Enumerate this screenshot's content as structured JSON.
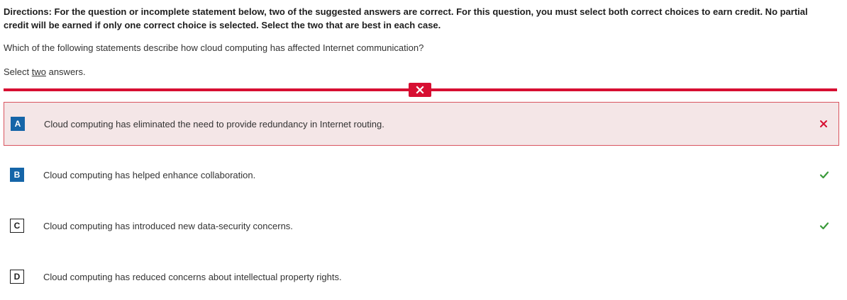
{
  "directions": "Directions: For the question or incomplete statement below, two of the suggested answers are correct. For this question, you must select both correct choices to earn credit. No partial credit will be earned if only one correct choice is selected. Select the two that are best in each case.",
  "question": "Which of the following statements describe how cloud computing has affected Internet communication?",
  "select_note": {
    "prefix": "Select ",
    "count_word": "two",
    "suffix": " answers."
  },
  "result": {
    "status": "incorrect",
    "icon": "x-icon",
    "color": "#d70f32"
  },
  "options": [
    {
      "letter": "A",
      "text": "Cloud computing has eliminated the need to provide redundancy in Internet routing.",
      "selected": true,
      "feedback": "incorrect"
    },
    {
      "letter": "B",
      "text": "Cloud computing has helped enhance collaboration.",
      "selected": true,
      "feedback": "correct"
    },
    {
      "letter": "C",
      "text": "Cloud computing has introduced new data-security concerns.",
      "selected": false,
      "feedback": "correct"
    },
    {
      "letter": "D",
      "text": "Cloud computing has reduced concerns about intellectual property rights.",
      "selected": false,
      "feedback": "none"
    }
  ],
  "colors": {
    "accent_blue": "#1565a8",
    "incorrect_red": "#d70f32",
    "incorrect_bg": "#f4e6e7",
    "correct_green": "#3a9a3a"
  }
}
